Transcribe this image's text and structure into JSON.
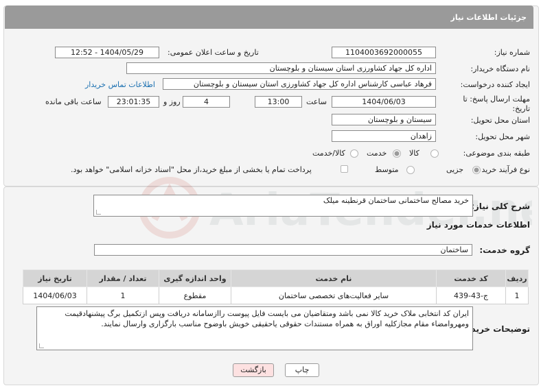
{
  "header": {
    "title": "جزئیات اطلاعات نیاز"
  },
  "fields": {
    "need_number": {
      "label": "شماره نیاز:",
      "value": "1104003692000055"
    },
    "announce_datetime": {
      "label": "تاریخ و ساعت اعلان عمومی:",
      "value": "1404/05/29 - 12:52"
    },
    "buyer_org": {
      "label": "نام دستگاه خریدار:",
      "value": "اداره کل جهاد کشاورزی استان سیستان و بلوچستان"
    },
    "requester": {
      "label": "ایجاد کننده درخواست:",
      "value": "فرهاد عباسی کارشناس  اداره کل جهاد کشاورزی استان سیستان و بلوچستان",
      "contact_link": "اطلاعات تماس خریدار"
    },
    "deadline": {
      "label": "مهلت ارسال پاسخ: تا تاریخ:",
      "date": "1404/06/03",
      "time_label": "ساعت",
      "time": "13:00",
      "days": "4",
      "days_label": "روز و",
      "remaining": "23:01:35",
      "remaining_label": "ساعت باقی مانده"
    },
    "province": {
      "label": "استان محل تحویل:",
      "value": "سیستان و بلوچستان"
    },
    "city": {
      "label": "شهر محل تحویل:",
      "value": "زاهدان"
    },
    "category": {
      "label": "طبقه بندی موضوعی:",
      "options": [
        "کالا",
        "خدمت",
        "کالا/خدمت"
      ],
      "selected": "خدمت"
    },
    "process_type": {
      "label": "نوع فرآیند خرید :",
      "options": [
        "جزیی",
        "متوسط"
      ],
      "selected": "جزیی",
      "payment_note": "پرداخت تمام یا بخشی از مبلغ خرید،از محل \"اسناد خزانه اسلامی\" خواهد بود."
    }
  },
  "summary": {
    "label": "شرح کلی نیاز:",
    "value": "خرید مصالح ساختمانی ساختمان قرنطینه میلک"
  },
  "services": {
    "section_title": "اطلاعات خدمات مورد نیاز",
    "group_label": "گروه خدمت:",
    "group_value": "ساختمان",
    "columns": [
      "ردیف",
      "کد خدمت",
      "نام خدمت",
      "واحد اندازه گیری",
      "تعداد / مقدار",
      "تاریخ نیاز"
    ],
    "rows": [
      {
        "row": "1",
        "code": "ج-43-439",
        "name": "سایر فعالیت‌های تخصصی ساختمان",
        "unit": "مقطوع",
        "qty": "1",
        "date": "1404/06/03"
      }
    ]
  },
  "buyer_notes": {
    "label": "توضیحات خریدار:",
    "value": "ایران کد انتخابی ملاک خرید کالا نمی باشد ومتقاضیان می بایست فایل پیوست راازسامانه دریافت وپس ازتکمیل برگ پیشنهادقیمت ومهروامضاء مقام مجازکلیه اوراق به همراه مستندات حقوقی یاحقیقی خویش باوضوح مناسب بارگزاری وارسال نمایند."
  },
  "buttons": {
    "print": "چاپ",
    "back": "بازگشت"
  },
  "watermark": {
    "text": "AriaTender.net"
  }
}
